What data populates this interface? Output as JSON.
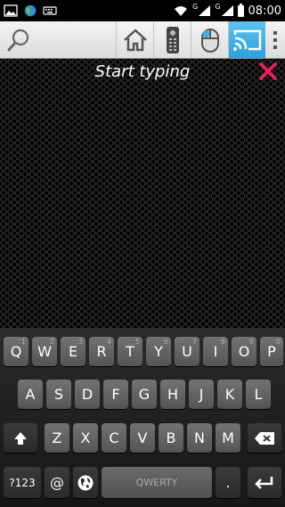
{
  "status": {
    "time": "08:00",
    "network_a": "G",
    "network_b": "G"
  },
  "toolbar": {
    "icons": [
      "search-icon",
      "home-icon",
      "remote-icon",
      "mouse-icon",
      "cast-icon",
      "overflow-menu-icon"
    ],
    "active": "cast-icon",
    "active_color": "#3ab0e6"
  },
  "main": {
    "title": "Start typing",
    "close_color": "#e2245a"
  },
  "keyboard": {
    "row1": [
      {
        "label": "Q",
        "num": "1"
      },
      {
        "label": "W",
        "num": "2"
      },
      {
        "label": "E",
        "num": "3"
      },
      {
        "label": "R",
        "num": "4"
      },
      {
        "label": "T",
        "num": "5"
      },
      {
        "label": "Y",
        "num": "6"
      },
      {
        "label": "U",
        "num": "7"
      },
      {
        "label": "I",
        "num": "8"
      },
      {
        "label": "O",
        "num": "9"
      },
      {
        "label": "P",
        "num": "0"
      }
    ],
    "row2": [
      "A",
      "S",
      "D",
      "F",
      "G",
      "H",
      "J",
      "K",
      "L"
    ],
    "row3": [
      "Z",
      "X",
      "C",
      "V",
      "B",
      "N",
      "M"
    ],
    "symbols_label": "?123",
    "at_label": "@",
    "space_label": "QWERTY",
    "period_label": "."
  }
}
